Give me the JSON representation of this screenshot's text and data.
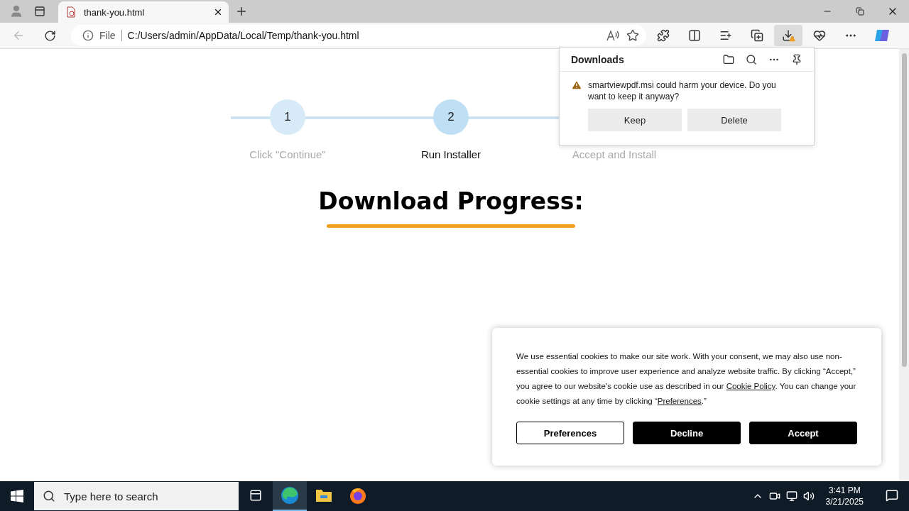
{
  "browser": {
    "tab": {
      "title": "thank-you.html",
      "selected": true
    },
    "address": {
      "scheme": "File",
      "url": "C:/Users/admin/AppData/Local/Temp/thank-you.html"
    }
  },
  "downloads": {
    "title": "Downloads",
    "message": "smartviewpdf.msi could harm your device. Do you want to keep it anyway?",
    "buttons": [
      "Keep",
      "Delete"
    ]
  },
  "steps": [
    {
      "number": "1",
      "label": "Click \"Continue\"",
      "selected": false
    },
    {
      "number": "2",
      "label": "Run Installer",
      "selected": true
    },
    {
      "label": "Accept and Install",
      "selected": false
    }
  ],
  "heading": "Download Progress:",
  "cookie_banner": {
    "segments": [
      {
        "kind": "text",
        "text": "We use essential cookies to make our site work. With your consent, we may also use non-essential cookies to improve user experience and analyze website traffic. By clicking “Accept,” you agree to our website's cookie use as described in our "
      },
      {
        "kind": "link",
        "text": "Cookie Policy"
      },
      {
        "kind": "text",
        "text": ". You can change your cookie settings at any time by clicking “"
      },
      {
        "kind": "link",
        "text": "Preferences"
      },
      {
        "kind": "text",
        "text": ".”"
      }
    ],
    "buttons": [
      {
        "label": "Preferences",
        "kind": "outline"
      },
      {
        "label": "Decline",
        "kind": "solid"
      },
      {
        "label": "Accept",
        "kind": "solid"
      }
    ]
  },
  "taskbar": {
    "search": {
      "placeholder": "Type here to search"
    },
    "apps": [
      {
        "kind": "edge",
        "selected": true
      },
      {
        "kind": "files",
        "selected": false
      },
      {
        "kind": "firefox",
        "selected": false
      }
    ],
    "time": "3:41 PM",
    "date": "3/21/2025"
  }
}
